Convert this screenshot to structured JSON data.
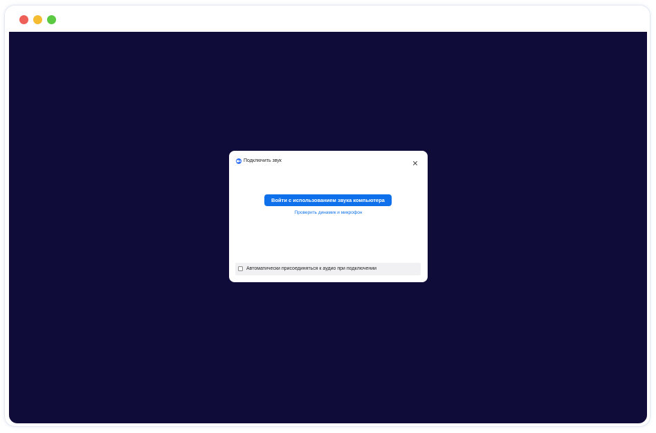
{
  "window": {
    "traffic_lights": {
      "close_color": "#ee5f57",
      "minimize_color": "#f5bc32",
      "maximize_color": "#5bc942"
    },
    "background_color": "#100c3a"
  },
  "dialog": {
    "title": "Подключить звук",
    "app_icon": "zoom-camera-icon",
    "close_icon": "close-icon",
    "primary_button_label": "Войти с использованием звука компьютера",
    "test_link_label": "Проверить динамик и микрофон",
    "auto_join": {
      "label": "Автоматически присоединяться к аудио при подключении",
      "checked": false
    },
    "accent_color": "#0e71eb"
  }
}
